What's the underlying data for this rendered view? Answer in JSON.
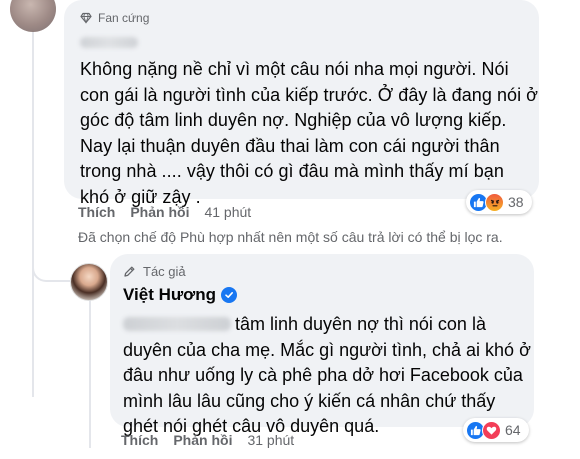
{
  "comment": {
    "badge": "Fan cứng",
    "lines": [
      "Không nặng nề chỉ vì một câu nói nha mọi người. Nói",
      "con gái là người tình của kiếp trước. Ở đây là đang nói ở",
      "góc độ tâm linh duyên nợ. Nghiệp của vô lượng kiếp.",
      "Nay lại thuận duyên đầu thai làm con cái người thân",
      "trong nhà .... vậy thôi có gì đâu mà mình thấy mí bạn",
      "khó ở giữ zậy ."
    ],
    "reactions": {
      "icons": [
        "like-icon",
        "angry-icon"
      ],
      "count": "38"
    },
    "actions": {
      "like": "Thích",
      "reply": "Phản hồi",
      "time": "41 phút"
    }
  },
  "filter_note": "Đã chọn chế độ Phù hợp nhất nên một số câu trả lời có thể bị lọc ra.",
  "reply": {
    "badge": "Tác giả",
    "author": "Việt Hương",
    "lines": [
      "tâm linh duyên nợ thì nói con là",
      "duyên của cha mẹ. Mắc gì người tình, chả ai khó ở",
      "đâu như uống ly cà phê pha dở hơi Facebook của",
      "mình lâu lâu cũng cho ý kiến cá nhân chứ thấy",
      "ghét nói ghét câu vô duyên quá."
    ],
    "reactions": {
      "icons": [
        "like-icon",
        "love-icon"
      ],
      "count": "64"
    },
    "actions": {
      "like": "Thích",
      "reply": "Phản hồi",
      "time": "31 phút"
    }
  },
  "colors": {
    "bubble": "#f0f2f5",
    "secondary_text": "#65676b",
    "like_blue": "#1877f2",
    "love_red": "#f33e58"
  }
}
